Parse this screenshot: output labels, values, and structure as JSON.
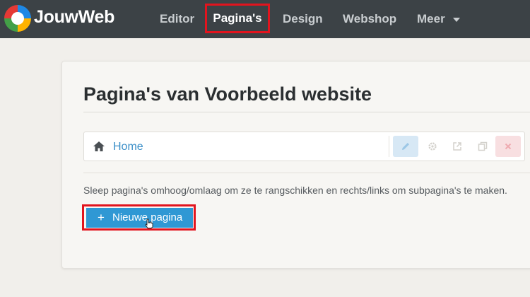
{
  "header": {
    "brand": "JouwWeb",
    "nav": [
      {
        "label": "Editor",
        "active": false
      },
      {
        "label": "Pagina's",
        "active": true
      },
      {
        "label": "Design",
        "active": false
      },
      {
        "label": "Webshop",
        "active": false
      },
      {
        "label": "Meer",
        "active": false,
        "has_dropdown": true
      }
    ],
    "highlight_color": "#e2141e"
  },
  "main": {
    "title": "Pagina's van Voorbeeld website",
    "pages": [
      {
        "label": "Home",
        "icon": "home-icon",
        "actions": [
          "pencil-icon",
          "gear-icon",
          "external-link-icon",
          "copy-icon",
          "close-icon"
        ]
      }
    ],
    "hint": "Sleep pagina's omhoog/omlaag om ze te rangschikken en rechts/links om subpagina's te maken.",
    "new_page_button": {
      "plus": "+",
      "label": "Nieuwe pagina"
    }
  },
  "colors": {
    "topbar": "#3c4246",
    "link": "#3b8fc8",
    "primary_button": "#2f98d4"
  }
}
